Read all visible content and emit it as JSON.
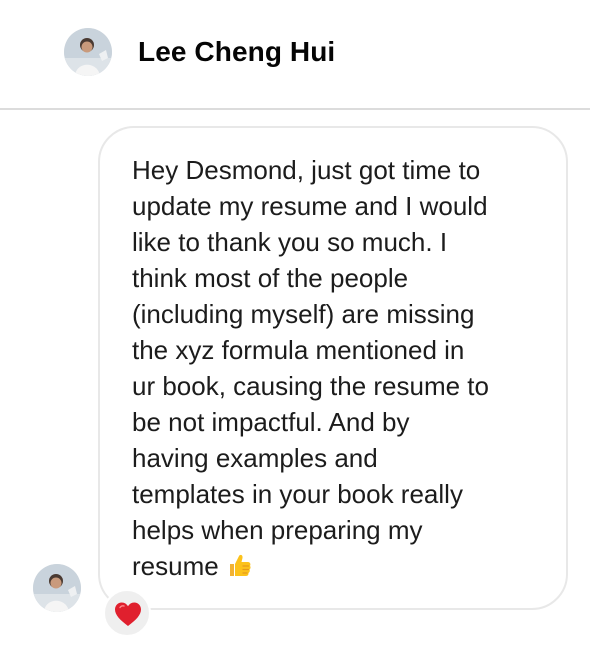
{
  "header": {
    "contact_name": "Lee Cheng Hui",
    "avatar_icon": "profile-photo"
  },
  "message": {
    "lines": [
      "Hey Desmond, just got time to",
      "update my resume and I would",
      "like to thank you so much. I",
      "think most of the people",
      "(including myself) are missing",
      "the xyz formula mentioned in",
      "ur book, causing the resume to",
      "be not impactful. And by",
      "having examples and",
      "templates in your book really",
      "helps when preparing my",
      "resume"
    ],
    "emoji": "thumbs-up-icon",
    "reaction": "heart-icon"
  },
  "colors": {
    "heart": "#e0202e",
    "bubble_border": "#e8e8e8",
    "divider": "#dcdcdc",
    "reaction_bg": "#efefef"
  }
}
